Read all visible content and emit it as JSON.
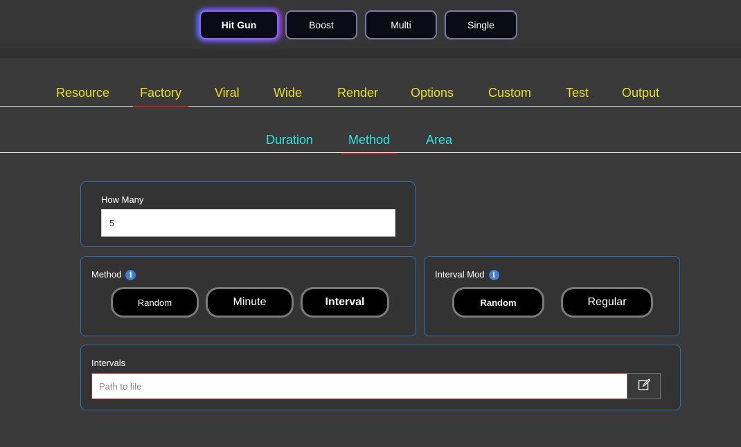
{
  "modes": [
    {
      "label": "Hit Gun",
      "active": true
    },
    {
      "label": "Boost",
      "active": false
    },
    {
      "label": "Multi",
      "active": false
    },
    {
      "label": "Single",
      "active": false
    }
  ],
  "main_tabs": [
    "Resource",
    "Factory",
    "Viral",
    "Wide",
    "Render",
    "Options",
    "Custom",
    "Test",
    "Output"
  ],
  "main_tab_active": "Factory",
  "sub_tabs": [
    "Duration",
    "Method",
    "Area"
  ],
  "sub_tab_active": "Method",
  "how_many": {
    "label": "How Many",
    "value": "5"
  },
  "method": {
    "label": "Method",
    "info_icon": "info-icon",
    "options": [
      "Random",
      "Minute",
      "Interval"
    ],
    "selected": "Interval"
  },
  "interval_mod": {
    "label": "Interval Mod",
    "info_icon": "info-icon",
    "options": [
      "Random",
      "Regular"
    ],
    "selected": "Random"
  },
  "intervals": {
    "label": "Intervals",
    "placeholder": "Path to file",
    "button_icon": "edit-icon"
  },
  "colors": {
    "main_tab": "#e6e02a",
    "sub_tab": "#2ee3e3",
    "active_underline": "#b3262c",
    "card_border": "#2a6fb0"
  }
}
